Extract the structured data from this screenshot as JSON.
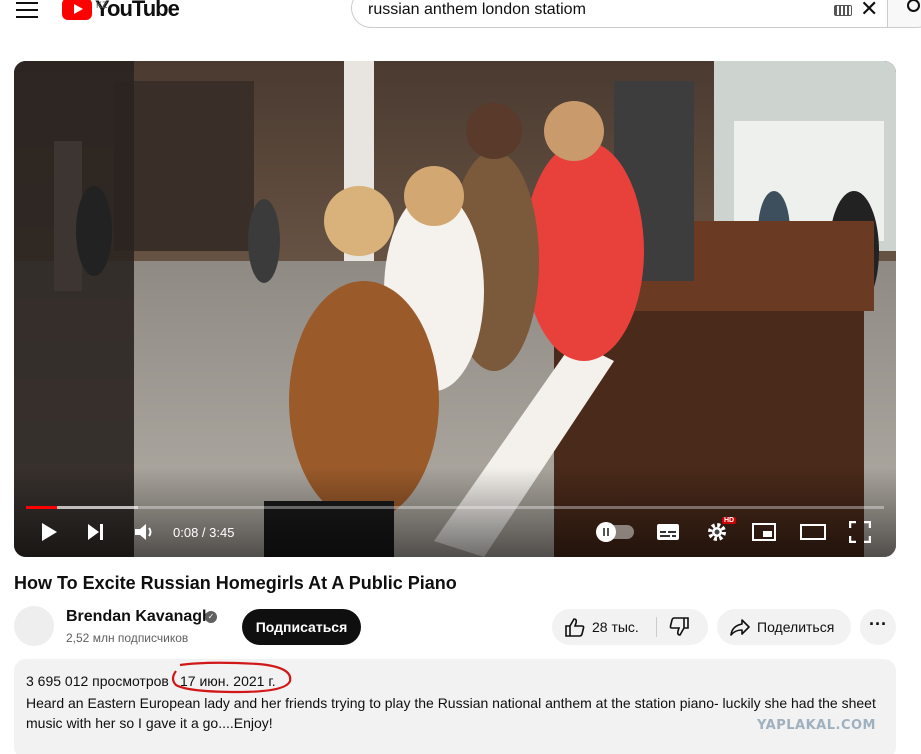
{
  "header": {
    "logo_text": "YouTube",
    "region": "KZ",
    "search_query": "russian anthem london statiom"
  },
  "player": {
    "current_time": "0:08",
    "duration": "3:45",
    "time_display": "0:08 / 3:45",
    "progress_fraction": 0.036,
    "buffered_fraction": 0.13,
    "hd_badge": "HD",
    "accent_color": "#ff0000"
  },
  "video": {
    "title": "How To Excite Russian Homegirls At A Public Piano"
  },
  "channel": {
    "name": "Brendan Kavanagh",
    "subscribers": "2,52 млн подписчиков",
    "subscribe_label": "Подписаться"
  },
  "actions": {
    "likes": "28 тыс.",
    "share_label": "Поделиться"
  },
  "description": {
    "views": "3 695 012 просмотров",
    "date": "17 июн. 2021 г.",
    "text": "Heard an Eastern European lady and her friends trying to play the Russian national anthem at the station piano- luckily she had the sheet music with her so I gave it a go....Enjoy!"
  },
  "watermark": "YAPLAKAL.COM"
}
